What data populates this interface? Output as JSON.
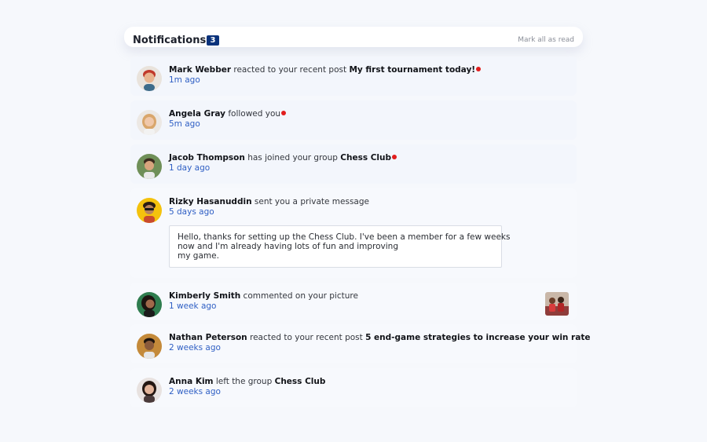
{
  "header": {
    "title": "Notifications",
    "count": "3",
    "mark_all": "Mark all as read"
  },
  "notifications": [
    {
      "name": "Mark Webber",
      "action": "reacted to your recent post",
      "target": "My first tournament today!",
      "time": "1m ago",
      "unread": true
    },
    {
      "name": "Angela Gray",
      "action": "followed you",
      "target": "",
      "time": "5m ago",
      "unread": true
    },
    {
      "name": "Jacob Thompson",
      "action": "has joined your group",
      "target": "Chess Club",
      "time": "1 day ago",
      "unread": true
    },
    {
      "name": "Rizky Hasanuddin",
      "action": "sent you a private message",
      "target": "",
      "time": "5 days ago",
      "unread": false,
      "message_lines": [
        "Hello, thanks for setting up the Chess Club. I've been a member for a few weeks",
        "now and I'm already having lots of fun and improving",
        "my game."
      ]
    },
    {
      "name": "Kimberly Smith",
      "action": "commented on your picture",
      "target": "",
      "time": "1 week ago",
      "unread": false
    },
    {
      "name": "Nathan Peterson",
      "action": "reacted to your recent post",
      "target": "5 end-game strategies to increase your win rate",
      "time": "2 weeks ago",
      "unread": false
    },
    {
      "name": "Anna Kim",
      "action": "left the group",
      "target": "Chess Club",
      "time": "2 weeks ago",
      "unread": false
    }
  ],
  "colors": {
    "badge": "#0a327b",
    "unread_dot": "#e11d1d",
    "time": "#2f5fc4"
  }
}
